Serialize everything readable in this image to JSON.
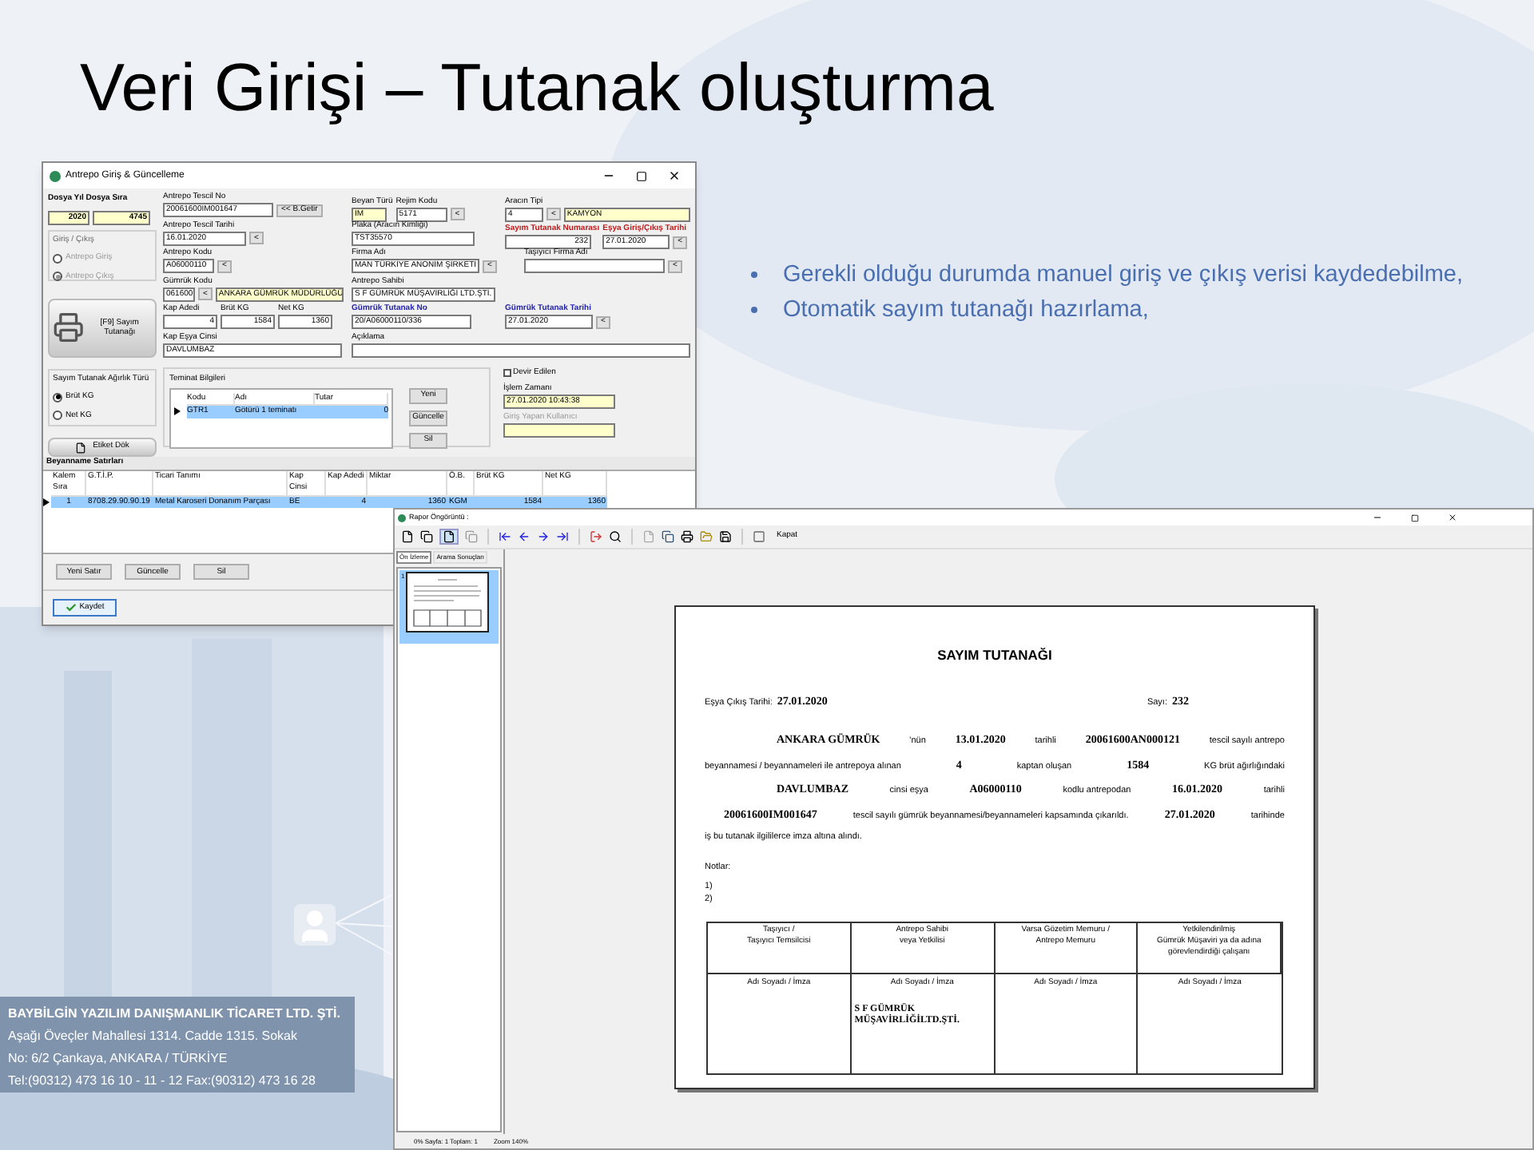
{
  "slide_title": "Veri Girişi – Tutanak oluşturma",
  "bullets": [
    "Gerekli olduğu durumda manuel giriş ve çıkış verisi kaydedebilme,",
    "Otomatik sayım tutanağı hazırlama,"
  ],
  "company": {
    "name": "BAYBİLGİN YAZILIM DANIŞMANLIK TİCARET LTD. ŞTİ.",
    "lines": [
      "Aşağı Öveçler Mahallesi 1314. Cadde 1315. Sokak",
      "No: 6/2 Çankaya, ANKARA / TÜRKİYE",
      "Tel:(90312) 473 16 10 - 11 - 12 Fax:(90312) 473 16 28"
    ]
  },
  "entry_window": {
    "title": "Antrepo Giriş & Güncelleme",
    "file": {
      "label": "Dosya Yıl Dosya Sıra",
      "year": "2020",
      "seq": "4745"
    },
    "direction": {
      "label": "Giriş / Çıkış",
      "options": [
        {
          "label": "Antrepo Giriş",
          "selected": false
        },
        {
          "label": "Antrepo Çıkış",
          "selected": true
        }
      ]
    },
    "print_button": "[F9] Sayım Tutanağı",
    "weight_type": {
      "label": "Sayım Tutanak Ağırlık Türü",
      "options": [
        {
          "label": "Brüt KG",
          "selected": true
        },
        {
          "label": "Net KG",
          "selected": false
        }
      ]
    },
    "label_button": "Etiket Dök",
    "fields": {
      "tescil_no": {
        "label": "Antrepo Tescil No",
        "value": "20061600IM001647",
        "button": "<< B.Getir"
      },
      "tescil_tarihi": {
        "label": "Antrepo Tescil Tarihi",
        "value": "16.01.2020",
        "button": "<"
      },
      "antrepo_kodu": {
        "label": "Antrepo Kodu",
        "value": "A06000110",
        "button": "<"
      },
      "gumruk_kodu": {
        "label": "Gümrük Kodu",
        "value": "061600",
        "button": "<",
        "name": "ANKARA GÜMRÜK MÜDÜRLÜĞÜ"
      },
      "kap_adedi": {
        "label": "Kap Adedi",
        "value": "4"
      },
      "brut_kg": {
        "label": "Brüt KG",
        "value": "1584"
      },
      "net_kg": {
        "label": "Net KG",
        "value": "1360"
      },
      "kap_esya": {
        "label": "Kap Eşya Cinsi",
        "value": "DAVLUMBAZ"
      },
      "beyan_turu": {
        "label": "Beyan Türü",
        "value": "IM"
      },
      "rejim_kodu": {
        "label": "Rejim Kodu",
        "value": "5171",
        "button": "<"
      },
      "plaka": {
        "label": "Plaka (Aracın Kimliği)",
        "value": "TST35570"
      },
      "firma": {
        "label": "Firma Adı",
        "value": "MAN TÜRKİYE ANONİM ŞİRKETİ",
        "button": "<"
      },
      "antrepo_sahibi": {
        "label": "Antrepo Sahibi",
        "value": "S F GÜMRÜK MÜŞAVİRLİĞİ LTD.ŞTİ."
      },
      "tutanak_no": {
        "label": "Gümrük Tutanak No",
        "value": "20/A06000110/336",
        "color": "#1f1fa8"
      },
      "aciklama": {
        "label": "Açıklama"
      },
      "arac_tipi": {
        "label": "Aracın Tipi",
        "value": "4",
        "button": "<",
        "name": "KAMYON"
      },
      "sayim_no": {
        "label": "Sayım Tutanak Numarası",
        "value": "232",
        "color": "#c01818"
      },
      "esya_tarihi": {
        "label": "Eşya Giriş/Çıkış Tarihi",
        "value": "27.01.2020",
        "button": "<",
        "color": "#c01818"
      },
      "tasiyici": {
        "label": "Taşıyıcı Firma Adı",
        "button": "<"
      },
      "tutanak_tarihi": {
        "label": "Gümrük Tutanak Tarihi",
        "value": "27.01.2020",
        "button": "<",
        "color": "#1f1fa8"
      }
    },
    "guarantee": {
      "label": "Teminat Bilgileri",
      "columns": [
        "Kodu",
        "Adı",
        "Tutar"
      ],
      "rows": [
        {
          "cells": [
            "GTR1",
            "Götürü 1 teminatı",
            "0"
          ],
          "selected": true
        }
      ],
      "buttons": [
        "Yeni",
        "Güncelle",
        "Sil"
      ]
    },
    "devir": {
      "label": "Devir Edilen",
      "checked": false
    },
    "islem_zamani": {
      "label": "İşlem Zamanı",
      "value": "27.01.2020 10:43:38"
    },
    "kullanici": {
      "label": "Giriş Yapan Kullanıcı"
    },
    "lines": {
      "label": "Beyanname Satırları",
      "columns": [
        "Kalem Sıra",
        "G.T.İ.P.",
        "Ticari Tanımı",
        "Kap Cinsi",
        "Kap Adedi",
        "Miktar",
        "Ö.B.",
        "Brüt KG",
        "Net KG"
      ],
      "rows": [
        {
          "cells": [
            "1",
            "8708.29.90.90.19",
            "Metal Karoseri Donanım Parçası",
            "BE",
            "4",
            "1360",
            "KGM",
            "1584",
            "1360"
          ],
          "selected": true
        }
      ],
      "buttons": [
        "Yeni Satır",
        "Güncelle",
        "Sil"
      ]
    },
    "save_button": "Kaydet"
  },
  "preview_window": {
    "title": "Rapor Öngörüntü :",
    "close_button": "Kapat",
    "tabs": [
      {
        "label": "Ön İzleme",
        "selected": true
      },
      {
        "label": "Arama Sonuçları",
        "selected": false
      }
    ],
    "thumbnails": [
      {
        "number": "1",
        "selected": true
      }
    ],
    "status": [
      "0% Sayfa: 1 Toplam: 1",
      "Zoom 140%"
    ],
    "report": {
      "title": "SAYIM TUTANAĞI",
      "date_label": "Eşya Çıkış Tarihi:",
      "date": "27.01.2020",
      "number_label": "Sayı:",
      "number": "232",
      "paragraph": [
        [
          {
            "kind": "value",
            "text": "ANKARA GÜMRÜK"
          },
          {
            "kind": "text",
            "text": "'nün"
          },
          {
            "kind": "value",
            "text": "13.01.2020"
          },
          {
            "kind": "text",
            "text": "tarihli"
          },
          {
            "kind": "value",
            "text": "20061600AN000121"
          },
          {
            "kind": "text",
            "text": "tescil sayılı antrepo"
          }
        ],
        [
          {
            "kind": "text",
            "text": "beyannamesi / beyannameleri ile antrepoya alınan"
          },
          {
            "kind": "value",
            "text": "4"
          },
          {
            "kind": "text",
            "text": "kaptan oluşan"
          },
          {
            "kind": "value",
            "text": "1584"
          },
          {
            "kind": "text",
            "text": "KG brüt ağırlığındaki"
          }
        ],
        [
          {
            "kind": "value",
            "text": "DAVLUMBAZ"
          },
          {
            "kind": "text",
            "text": "cinsi eşya"
          },
          {
            "kind": "value",
            "text": "A06000110"
          },
          {
            "kind": "text",
            "text": "kodlu antrepodan"
          },
          {
            "kind": "value",
            "text": "16.01.2020"
          },
          {
            "kind": "text",
            "text": "tarihli"
          }
        ],
        [
          {
            "kind": "value",
            "text": "20061600IM001647"
          },
          {
            "kind": "text",
            "text": "tescil sayılı gümrük beyannamesi/beyannameleri kapsamında çıkarıldı."
          },
          {
            "kind": "value",
            "text": "27.01.2020"
          },
          {
            "kind": "text",
            "text": "tarihinde"
          }
        ],
        [
          {
            "kind": "text",
            "text": "iş bu tutanak ilgililerce imza altına alındı."
          }
        ]
      ],
      "notes_label": "Notlar:",
      "notes": [
        "1)",
        "2)"
      ],
      "signatures": [
        {
          "header": [
            "Taşıyıcı /",
            "Taşıyıcı Temsilcisi"
          ],
          "sign": "Adı Soyadı / İmza"
        },
        {
          "header": [
            "Antrepo Sahibi",
            "veya Yetkilisi"
          ],
          "sign": "Adı Soyadı / İmza",
          "name": [
            "S F GÜMRÜK",
            "MÜŞAVİRLİĞİLTD.ŞTİ."
          ]
        },
        {
          "header": [
            "Varsa Gözetim Memuru /",
            "Antrepo Memuru"
          ],
          "sign": "Adı Soyadı / İmza"
        },
        {
          "header": [
            "Yetkilendirilmiş",
            "Gümrük Müşaviri ya da adına",
            "görevlendirdiği çalışanı"
          ],
          "sign": "Adı Soyadı / İmza"
        }
      ]
    }
  }
}
